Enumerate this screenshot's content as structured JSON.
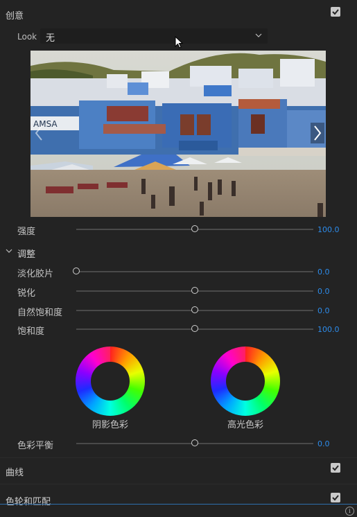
{
  "creative": {
    "title": "创意",
    "checked": true,
    "look_label": "Look",
    "look_value": "无",
    "intensity": {
      "label": "强度",
      "value": "100.0",
      "fraction": 0.5
    }
  },
  "adjustments": {
    "title": "调整",
    "sliders": [
      {
        "label": "淡化胶片",
        "value": "0.0",
        "fraction": 0.0
      },
      {
        "label": "锐化",
        "value": "0.0",
        "fraction": 0.5
      },
      {
        "label": "自然饱和度",
        "value": "0.0",
        "fraction": 0.5
      },
      {
        "label": "饱和度",
        "value": "100.0",
        "fraction": 0.5
      }
    ],
    "shadow_tint_label": "阴影色彩",
    "highlight_tint_label": "高光色彩",
    "tint_balance": {
      "label": "色彩平衡",
      "value": "0.0",
      "fraction": 0.5
    }
  },
  "curves": {
    "title": "曲线",
    "checked": true
  },
  "color_wheels": {
    "title": "色轮和匹配",
    "checked": true
  },
  "icons": {
    "expand": "chevron-down-icon",
    "dropdown": "chevron-down-icon",
    "prev": "chevron-left-icon",
    "next": "chevron-right-icon",
    "info": "info-icon",
    "check": "checkmark-icon"
  },
  "colors": {
    "value_accent": "#2d8ceb",
    "panel_bg": "#232323"
  }
}
